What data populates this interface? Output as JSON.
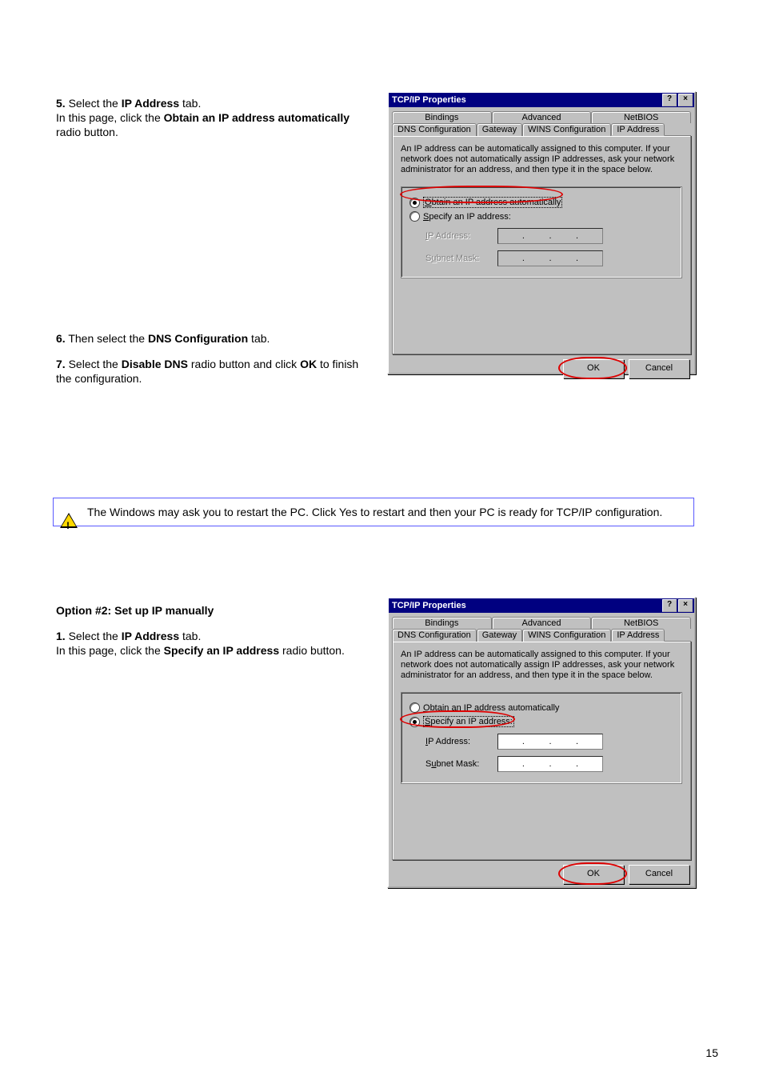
{
  "dialog": {
    "title": "TCP/IP Properties",
    "help_btn": "?",
    "close_btn": "×",
    "tabs_row1": [
      "Bindings",
      "Advanced",
      "NetBIOS"
    ],
    "tabs_row2": [
      "DNS Configuration",
      "Gateway",
      "WINS Configuration",
      "IP Address"
    ],
    "description": "An IP address can be automatically assigned to this computer. If your network does not automatically assign IP addresses, ask your network administrator for an address, and then type it in the space below.",
    "radio_auto": "Obtain an IP address automatically",
    "radio_specify": "Specify an IP address:",
    "field_ip": "IP Address:",
    "field_mask": "Subnet Mask:",
    "ok": "OK",
    "cancel": "Cancel"
  },
  "instr1": {
    "step5_num": "5.",
    "step5_a": "Select the ",
    "step5_b": "IP Address",
    "step5_c": " tab.",
    "step5_line2a": "In this page, click the ",
    "step5_line2b": "Obtain an IP address automatically",
    "step5_line2c": " radio button.",
    "step6_num": "6.",
    "step6_a": "Then select the ",
    "step6_b": "DNS Configuration",
    "step6_c": " tab.",
    "step7_num": "7.",
    "step7_a": "Select the ",
    "step7_b": "Disable DNS",
    "step7_c": " radio button and click ",
    "step7_d": "OK",
    "step7_e": " to finish the configuration."
  },
  "note": {
    "line": " The Windows may ask you to restart the PC. Click Yes to restart and then your PC is ready for TCP/IP configuration."
  },
  "instr2": {
    "heading": "Option #2:  Set up IP manually ",
    "step1_num": "1.",
    "step1_a": "Select the ",
    "step1_b": "IP Address",
    "step1_c": " tab.",
    "step1_line2a": "In this page, click the ",
    "step1_line2b": "Specify an IP address",
    "step1_line2c": " radio button."
  },
  "page_num": "15"
}
